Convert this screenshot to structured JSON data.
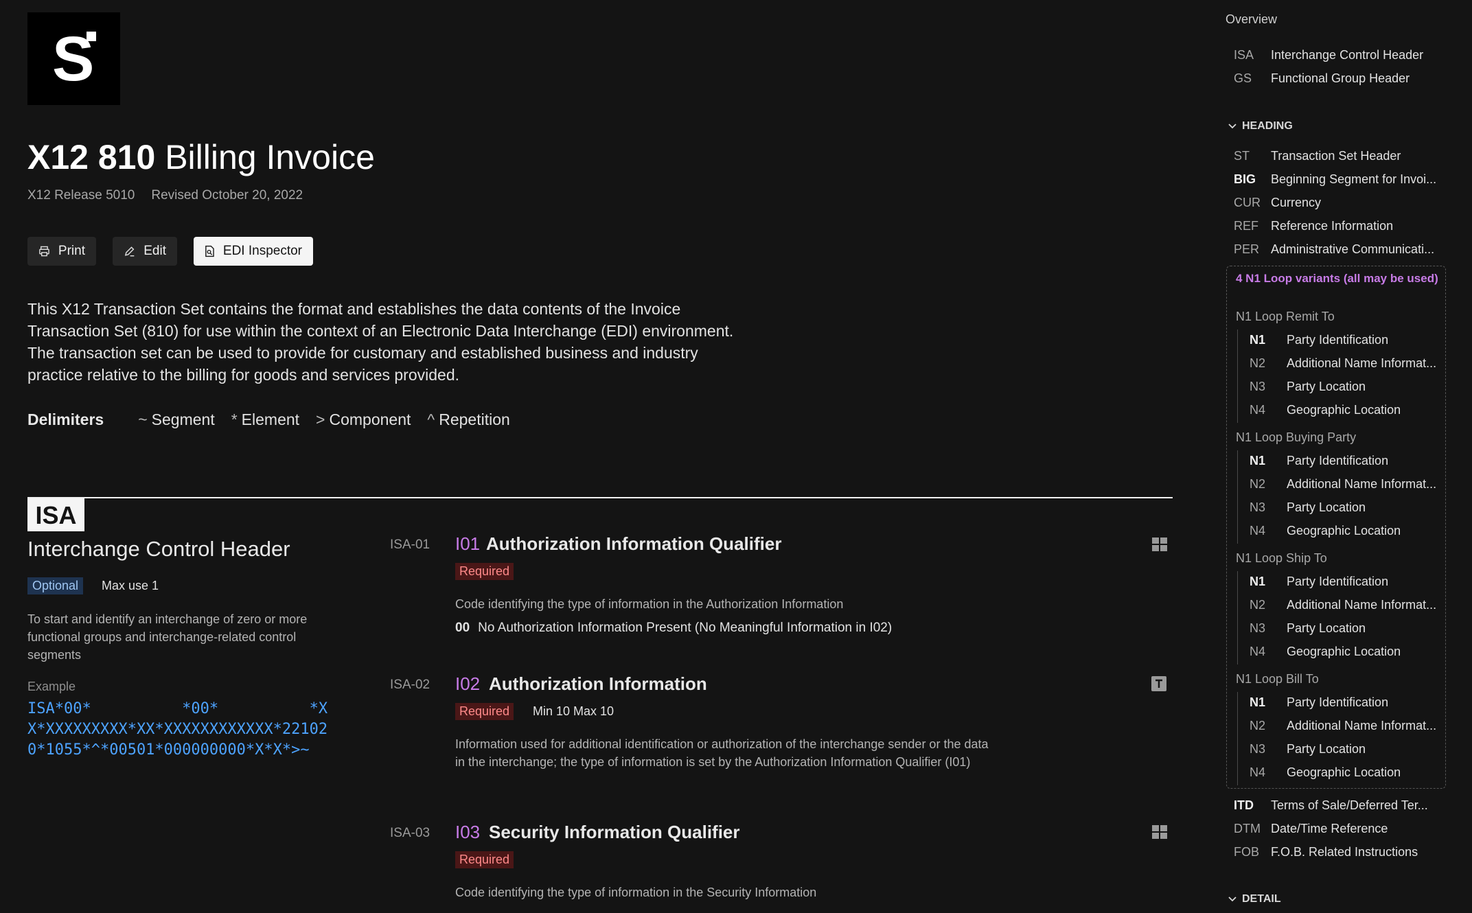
{
  "header": {
    "title_bold": "X12 810",
    "title_rest": "Billing Invoice",
    "release": "X12 Release 5010",
    "revised": "Revised October 20, 2022"
  },
  "toolbar": {
    "print": "Print",
    "edit": "Edit",
    "inspector": "EDI Inspector"
  },
  "description": "This X12 Transaction Set contains the format and establishes the data contents of the Invoice Transaction Set (810) for use within the context of an Electronic Data Interchange (EDI) environment. The transaction set can be used to provide for customary and established business and industry practice relative to the billing for goods and services provided.",
  "delimiters": {
    "label": "Delimiters",
    "items": [
      {
        "symbol": "~",
        "name": "Segment"
      },
      {
        "symbol": "*",
        "name": "Element"
      },
      {
        "symbol": ">",
        "name": "Component"
      },
      {
        "symbol": "^",
        "name": "Repetition"
      }
    ]
  },
  "segment": {
    "badge": "ISA",
    "title": "Interchange Control Header",
    "optional": "Optional",
    "max_use": "Max use 1",
    "description": "To start and identify an interchange of zero or more functional groups and interchange-related control segments",
    "example_label": "Example",
    "example_lines": [
      "ISA*00*          *00*          *X",
      "X*XXXXXXXXX*XX*XXXXXXXXXXXX*22102",
      "0*1055*^*00501*000000000*X*X*>~"
    ]
  },
  "elements": [
    {
      "id": "ISA-01",
      "code": "I01",
      "name": "Authorization Information Qualifier",
      "required": "Required",
      "minmax": "",
      "description": "Code identifying the type of information in the Authorization Information",
      "code_value": "00",
      "code_desc": "No Authorization Information Present (No Meaningful Information in I02)",
      "icon": "grid-icon"
    },
    {
      "id": "ISA-02",
      "code": "I02",
      "name": "Authorization Information",
      "required": "Required",
      "minmax": "Min 10 Max 10",
      "description": "Information used for additional identification or authorization of the interchange sender or the data in the interchange; the type of information is set by the Authorization Information Qualifier (I01)",
      "icon": "text-type-icon"
    },
    {
      "id": "ISA-03",
      "code": "I03",
      "name": "Security Information Qualifier",
      "required": "Required",
      "minmax": "",
      "description": "Code identifying the type of information in the Security Information",
      "icon": "grid-icon"
    }
  ],
  "sidebar": {
    "overview": "Overview",
    "top_items": [
      {
        "code": "ISA",
        "name": "Interchange Control Header"
      },
      {
        "code": "GS",
        "name": "Functional Group Header"
      }
    ],
    "heading_label": "HEADING",
    "heading_items": [
      {
        "code": "ST",
        "name": "Transaction Set Header"
      },
      {
        "code": "BIG",
        "name": "Beginning Segment for Invoi..."
      },
      {
        "code": "CUR",
        "name": "Currency"
      },
      {
        "code": "REF",
        "name": "Reference Information"
      },
      {
        "code": "PER",
        "name": "Administrative Communicati..."
      }
    ],
    "loop_title": "4 N1 Loop variants (all may be used)",
    "loops": [
      {
        "name": "N1 Loop Remit To",
        "items": [
          {
            "code": "N1",
            "name": "Party Identification"
          },
          {
            "code": "N2",
            "name": "Additional Name Informat..."
          },
          {
            "code": "N3",
            "name": "Party Location"
          },
          {
            "code": "N4",
            "name": "Geographic Location"
          }
        ]
      },
      {
        "name": "N1 Loop Buying Party",
        "items": [
          {
            "code": "N1",
            "name": "Party Identification"
          },
          {
            "code": "N2",
            "name": "Additional Name Informat..."
          },
          {
            "code": "N3",
            "name": "Party Location"
          },
          {
            "code": "N4",
            "name": "Geographic Location"
          }
        ]
      },
      {
        "name": "N1 Loop Ship To",
        "items": [
          {
            "code": "N1",
            "name": "Party Identification"
          },
          {
            "code": "N2",
            "name": "Additional Name Informat..."
          },
          {
            "code": "N3",
            "name": "Party Location"
          },
          {
            "code": "N4",
            "name": "Geographic Location"
          }
        ]
      },
      {
        "name": "N1 Loop Bill To",
        "items": [
          {
            "code": "N1",
            "name": "Party Identification"
          },
          {
            "code": "N2",
            "name": "Additional Name Informat..."
          },
          {
            "code": "N3",
            "name": "Party Location"
          },
          {
            "code": "N4",
            "name": "Geographic Location"
          }
        ]
      }
    ],
    "after_items": [
      {
        "code": "ITD",
        "name": "Terms of Sale/Deferred Ter..."
      },
      {
        "code": "DTM",
        "name": "Date/Time Reference"
      },
      {
        "code": "FOB",
        "name": "F.O.B. Related Instructions"
      }
    ],
    "detail_label": "DETAIL"
  }
}
